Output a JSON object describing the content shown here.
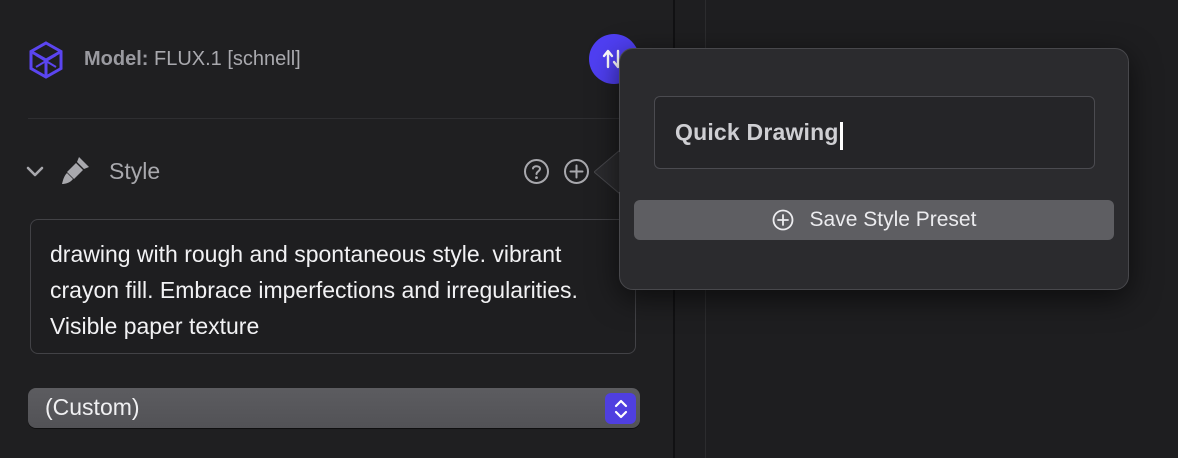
{
  "model": {
    "label": "Model:",
    "name": "FLUX.1 [schnell]"
  },
  "style_section": {
    "title": "Style",
    "prompt": "drawing with rough and spontaneous style. vibrant crayon fill. Embrace imperfections and irregularities. Visible paper texture",
    "preset_value": "(Custom)"
  },
  "popover": {
    "name_value": "Quick Drawing",
    "save_label": "Save Style Preset"
  },
  "colors": {
    "accent": "#4f3ff2",
    "background": "#1f1f21"
  },
  "icons": [
    "model-cube-icon",
    "switch-model-icon",
    "chevron-down-icon",
    "brush-icon",
    "help-icon",
    "add-icon",
    "stepper-icon",
    "plus-circle-icon"
  ]
}
